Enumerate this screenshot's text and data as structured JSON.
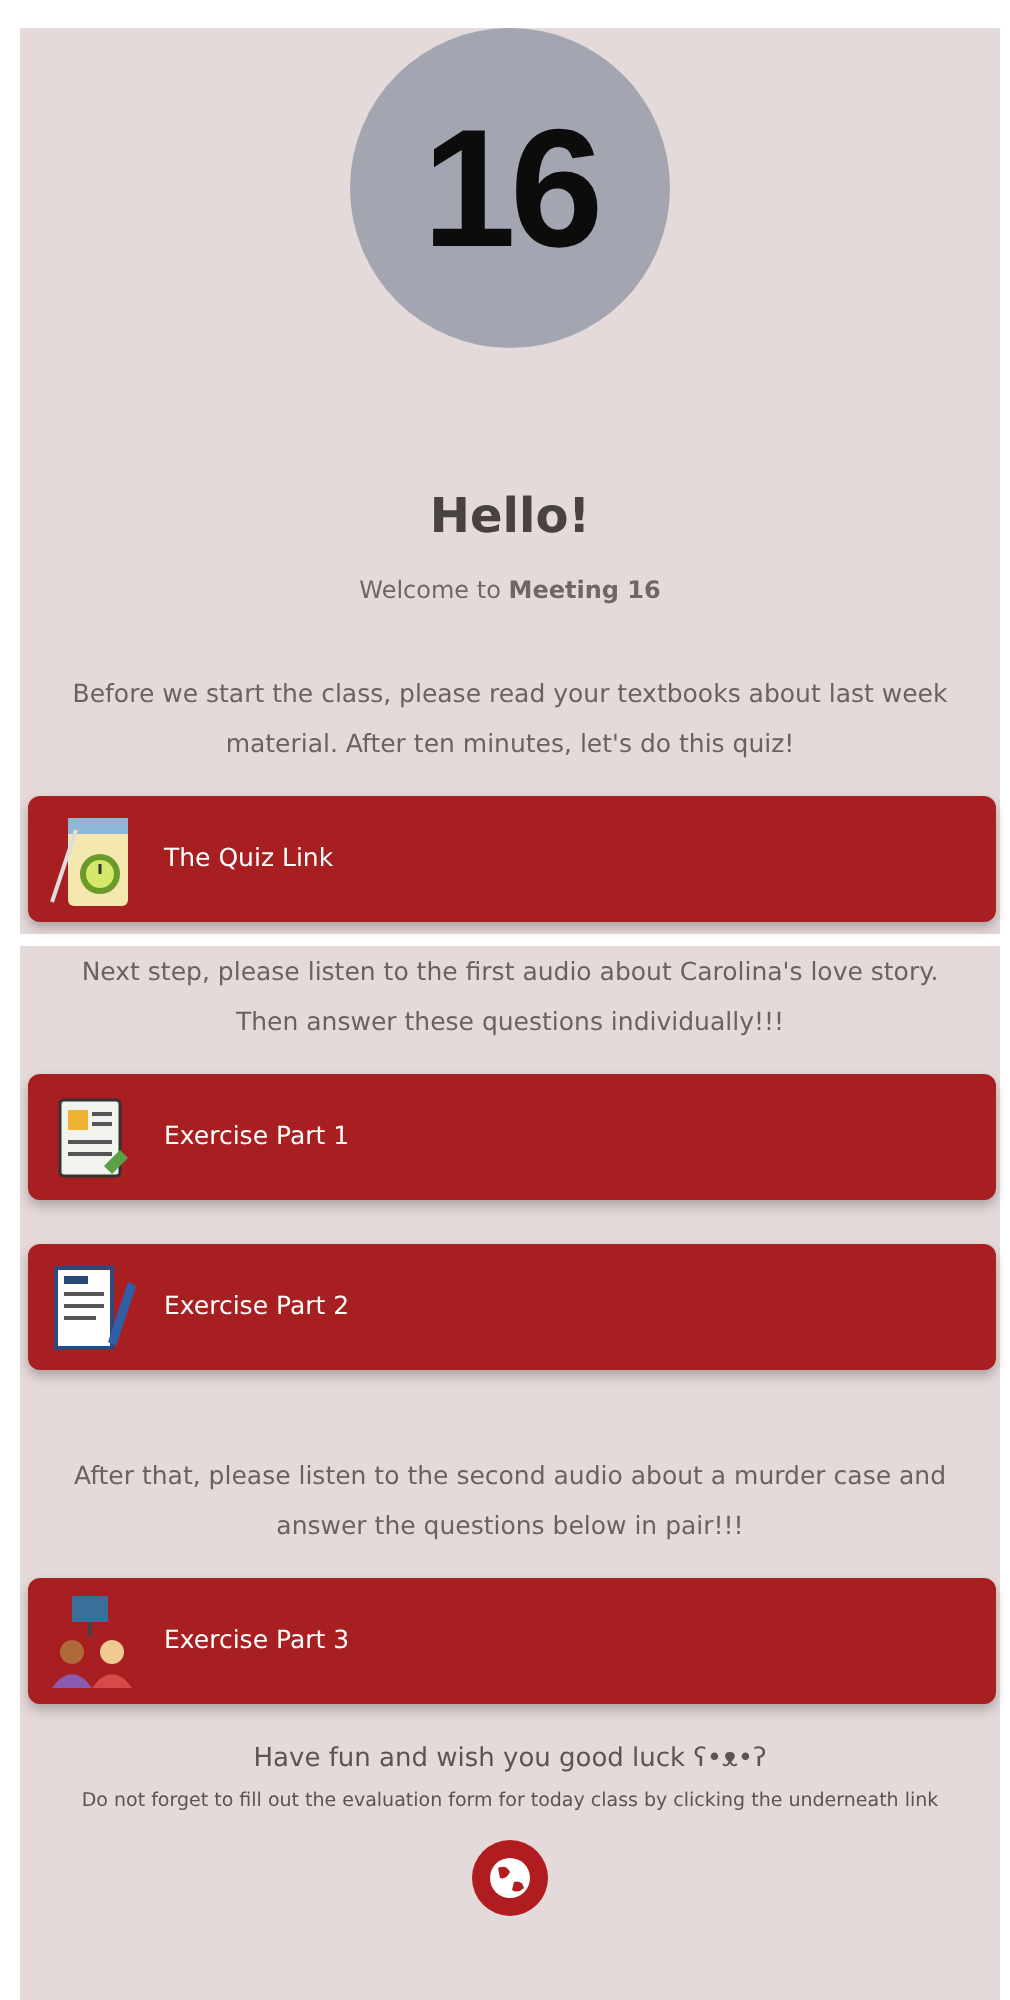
{
  "header": {
    "number": "16",
    "greeting": "Hello!",
    "welcome": "Welcome to **Meeting 16**"
  },
  "panels": [
    {
      "blocks": [
        {
          "kind": "text",
          "text": "Before we start the class, please read your textbooks about last week material. After ten minutes, let's do this quiz!"
        },
        {
          "kind": "link",
          "label": "The Quiz Link"
        }
      ]
    },
    {
      "blocks": [
        {
          "kind": "text",
          "text": "Next step, please listen to the first audio about Carolina's love story. Then answer these questions individually!!!"
        },
        {
          "kind": "link",
          "label": "Exercise Part 1"
        },
        {
          "kind": "link",
          "label": "Exercise Part 2"
        },
        {
          "kind": "text",
          "text": "After that, please listen to the second audio about a murder case and answer the questions below in pair!!!"
        },
        {
          "kind": "link",
          "label": "Exercise Part 3"
        },
        {
          "kind": "closing",
          "text": "Have fun and wish you good luck ʕ•ᴥ•ʔ"
        },
        {
          "kind": "note",
          "text": "Do not forget to fill out the evaluation form for today class by clicking the underneath link"
        },
        {
          "kind": "round-link"
        }
      ]
    }
  ]
}
